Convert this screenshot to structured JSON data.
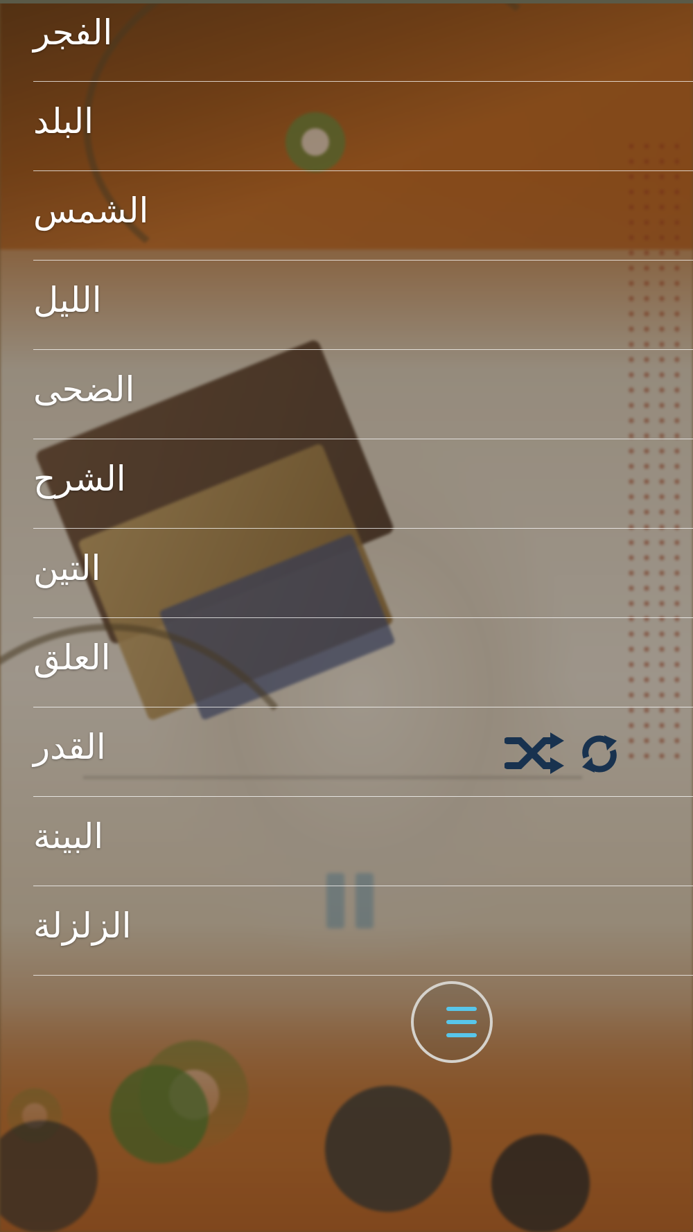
{
  "surah_list": {
    "items": [
      {
        "label": "الفجر"
      },
      {
        "label": "البلد"
      },
      {
        "label": "الشمس"
      },
      {
        "label": "الليل"
      },
      {
        "label": "الضحى"
      },
      {
        "label": "الشرح"
      },
      {
        "label": "التين"
      },
      {
        "label": "العلق"
      },
      {
        "label": "القدر"
      },
      {
        "label": "البينة"
      },
      {
        "label": "الزلزلة"
      }
    ]
  },
  "player": {
    "shuffle_icon": "shuffle-icon",
    "repeat_icon": "repeat-icon",
    "accent_color": "#0f3f73"
  },
  "menu_button": {
    "icon": "menu-icon",
    "accent_color": "#58c6ea"
  }
}
